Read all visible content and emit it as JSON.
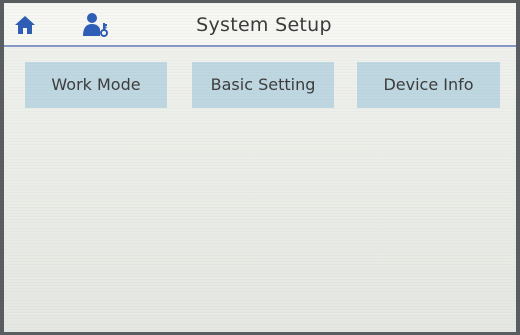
{
  "header": {
    "title": "System Setup",
    "home_icon": "home-icon",
    "user_icon": "user-key-icon",
    "accent_color": "#2f5eb7"
  },
  "tabs": [
    {
      "label": "Work Mode"
    },
    {
      "label": "Basic Setting"
    },
    {
      "label": "Device Info"
    }
  ]
}
